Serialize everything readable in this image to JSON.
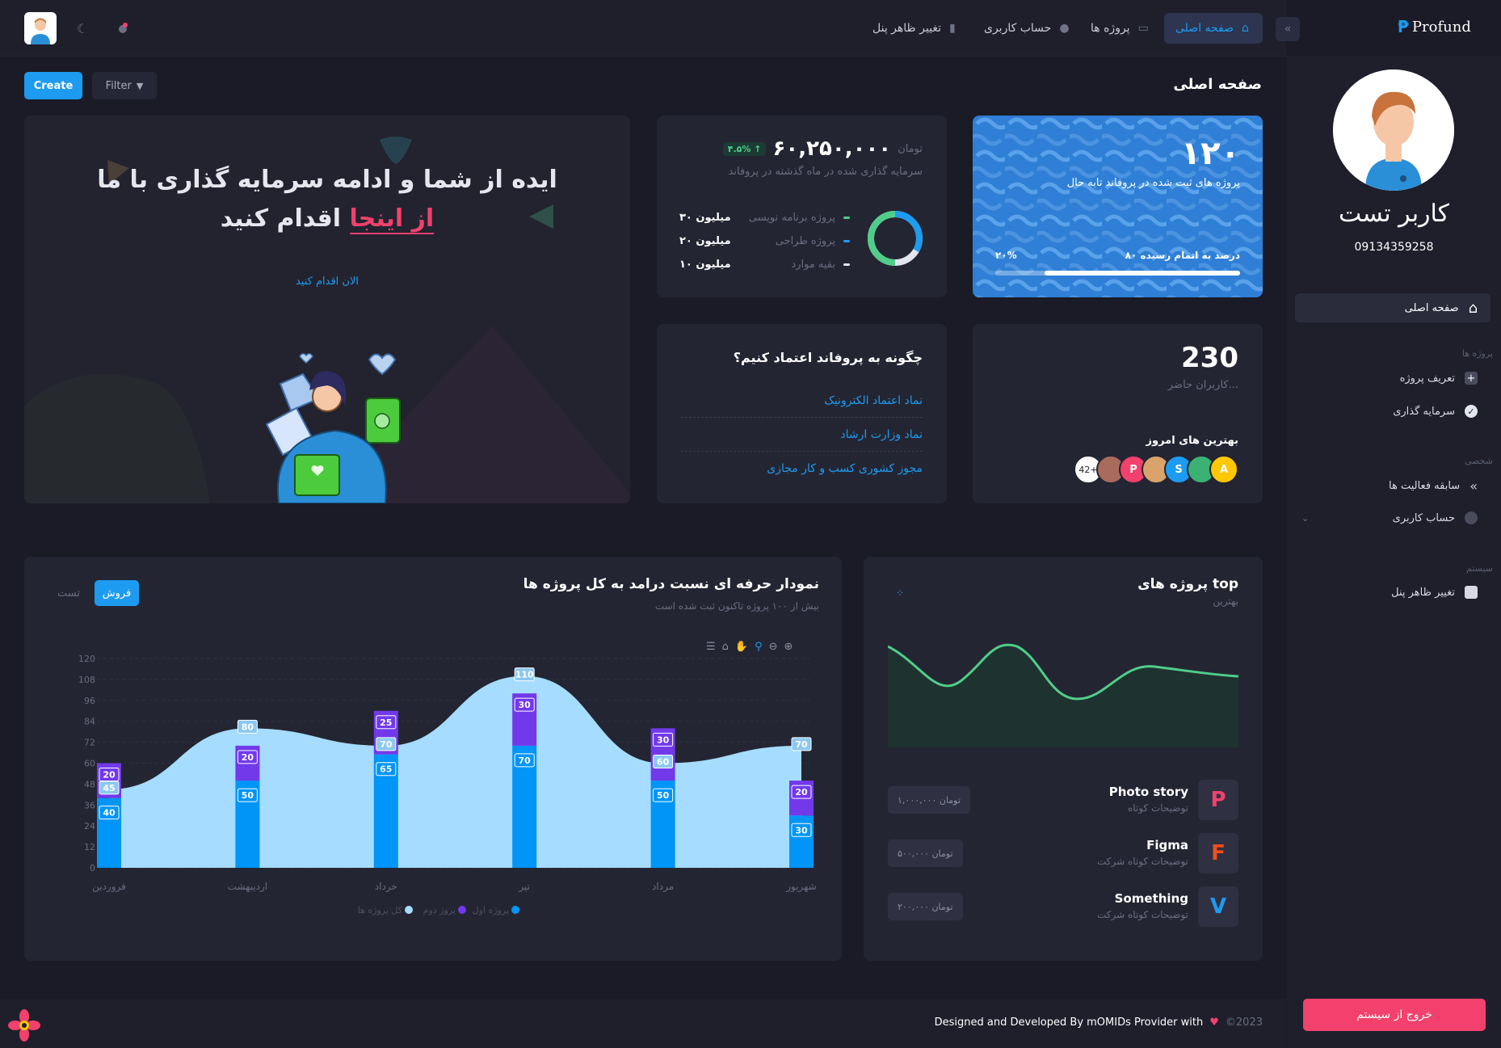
{
  "brand": {
    "name": "Profund"
  },
  "topnav": {
    "items": [
      {
        "label": "صفحه اصلی"
      },
      {
        "label": "پروژه ها"
      },
      {
        "label": "حساب کاربری"
      },
      {
        "label": "تغییر ظاهر پنل"
      }
    ]
  },
  "sidebar": {
    "user_name": "کاربر تست",
    "user_phone": "09134359258",
    "home": "صفحه اصلی",
    "sec_projects": "پروژه ها",
    "define_project": "تعریف پروژه",
    "investment": "سرمایه گذاری",
    "sec_personal": "شخصی",
    "activity_history": "سابقه فعالیت ها",
    "account": "حساب کاربری",
    "sec_system": "سیستم",
    "appearance": "تغییر ظاهر پنل",
    "logout": "خروج از سیستم"
  },
  "toolbar": {
    "create": "Create",
    "filter": "Filter"
  },
  "page": {
    "title": "صفحه اصلی"
  },
  "stats_card": {
    "number": "۱۲۰",
    "subtitle": "پروژه های ثبت شده در پروفاند تابه حال",
    "progress_label": "۸۰ درصد به اتمام رسیده",
    "progress_percent_text": "۲۰%",
    "progress_value": 0.8
  },
  "investment_card": {
    "currency": "تومان",
    "amount": "۶۰,۲۵۰,۰۰۰",
    "change": "۴.۵%",
    "caption": "سرمایه گذاری شده در ماه گذشته در پروفاند",
    "rows": [
      {
        "label": "پروژه برنامه نویسی",
        "value": "۳۰ میلیون",
        "color": "#50cd89"
      },
      {
        "label": "پروژه طراحی",
        "value": "۲۰ میلیون",
        "color": "#1d9bf0"
      },
      {
        "label": "بقیه موارد",
        "value": "۱۰ میلیون",
        "color": "#e4e6ef"
      }
    ]
  },
  "hero": {
    "line1": "ایده از شما و ادامه سرمایه گذاری با ما",
    "highlight": "از اینجا",
    "line2_rest": "اقدام کنید",
    "cta": "الان اقدام کنید"
  },
  "users_card": {
    "count": "230",
    "caption": "کاربران حاضر...",
    "best_title": "بهترین های امروز",
    "avatars": [
      {
        "letter": "A",
        "color": "#ffc700"
      },
      {
        "letter": "",
        "color": "#3bb273"
      },
      {
        "letter": "S",
        "color": "#1d9bf0"
      },
      {
        "letter": "",
        "color": "#d9a36b"
      },
      {
        "letter": "P",
        "color": "#f1416c"
      },
      {
        "letter": "",
        "color": "#a86b5c"
      }
    ],
    "more": "42+"
  },
  "trust_card": {
    "title": "چگونه به پروفاند اعتماد کنیم؟",
    "links": [
      "نماد اعتماد الکترونیک",
      "نماد وزارت ارشاد",
      "مجوز کشوری کسب و کار مجازی"
    ]
  },
  "revenue_chart": {
    "title": "نمودار حرفه ای نسبت درامد به کل پروژه ها",
    "subtitle": "بیش از ۱۰۰ پروژه تاکنون ثبت شده است",
    "tab_active": "فروش",
    "tab_inactive": "تست"
  },
  "chart_data": {
    "type": "bar",
    "categories": [
      "فروردین",
      "اردیبهشت",
      "خرداد",
      "تیر",
      "مرداد",
      "شهریور"
    ],
    "series": [
      {
        "name": "پروژه اول",
        "values": [
          40,
          50,
          65,
          70,
          50,
          30
        ],
        "color": "#0095f6"
      },
      {
        "name": "پروژ دوم",
        "values": [
          20,
          20,
          25,
          30,
          30,
          20
        ],
        "color": "#7239ea"
      },
      {
        "name": "کل پروژه ها",
        "values": [
          45,
          80,
          70,
          110,
          60,
          70
        ],
        "color": "#a6dcff"
      }
    ],
    "yticks": [
      0,
      12,
      24,
      36,
      48,
      60,
      72,
      84,
      96,
      108,
      120
    ],
    "ylim": [
      0,
      120
    ]
  },
  "top_projects": {
    "title": "پروژه های top",
    "subtitle": "بهترین",
    "items": [
      {
        "name": "Photo story",
        "desc": "توضیحات کوتاه",
        "price": "۱,۰۰۰,۰۰۰ تومان",
        "icon": "P",
        "icon_color": "#f1416c"
      },
      {
        "name": "Figma",
        "desc": "توضیحات کوتاه شرکت",
        "price": "۵۰۰,۰۰۰ تومان",
        "icon": "F",
        "icon_color": "#f24e1e"
      },
      {
        "name": "Something",
        "desc": "توضیحات کوتاه شرکت",
        "price": "۲۰۰,۰۰۰ تومان",
        "icon": "V",
        "icon_color": "#1d9bf0"
      }
    ]
  },
  "footer": {
    "year": "©2023",
    "credit": "Designed and Developed By mOMIDs Provider with"
  }
}
